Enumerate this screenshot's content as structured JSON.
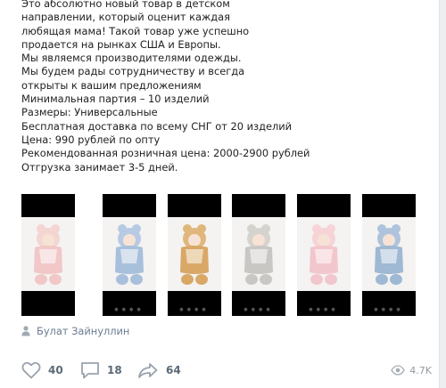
{
  "post": {
    "text_lines": [
      "Это абсолютно новый товар в детском",
      "направлении, который оценит каждая",
      "любящая мама! Такой товар уже успешно",
      "продается на рынках США и Европы.",
      "Мы являемся производителями одежды.",
      "Мы будем рады сотрудничеству и всегда",
      "открыты к вашим предложениям",
      "Минимальная партия – 10 изделий",
      "Размеры: Универсальные",
      "Бесплатная доставка по всему СНГ от 20 изделий",
      "Цена: 990 рублей по опту",
      "Рекомендованная розничная цена: 2000-2900 рублей",
      "Отгрузка занимает 3-5 дней."
    ],
    "author": "Булат Зайнуллин",
    "author_icon": "user-icon"
  },
  "gallery": {
    "photos": [
      {
        "color": "#f1c7c7",
        "hood": "#f3d5d2"
      },
      {
        "color": "#a9c0dc",
        "hood": "#b7cae3"
      },
      {
        "color": "#d9a867",
        "hood": "#e0b67a"
      },
      {
        "color": "#c9c7c3",
        "hood": "#d6d3cf"
      },
      {
        "color": "#f2c6cd",
        "hood": "#f5d3d7"
      },
      {
        "color": "#9fb8d3",
        "hood": "#aec4dc"
      }
    ]
  },
  "actions": {
    "likes": "40",
    "comments": "18",
    "shares": "64",
    "views": "4.7K",
    "like_icon": "heart-icon",
    "comment_icon": "comment-icon",
    "share_icon": "share-icon",
    "views_icon": "eye-icon"
  },
  "colors": {
    "icon": "#99a2ad",
    "link": "#6a7c90"
  }
}
